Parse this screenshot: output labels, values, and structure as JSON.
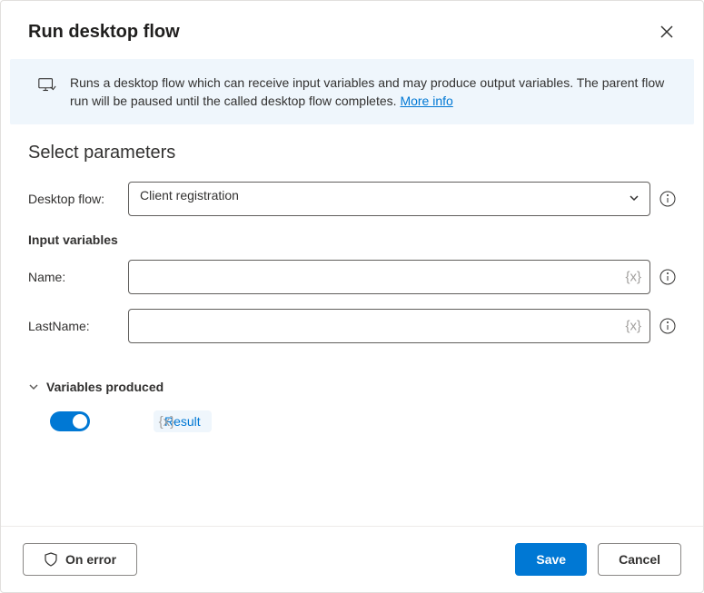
{
  "dialog": {
    "title": "Run desktop flow",
    "description": "Runs a desktop flow which can receive input variables and may produce output variables. The parent flow run will be paused until the called desktop flow completes.",
    "moreInfoLabel": "More info"
  },
  "parameters": {
    "heading": "Select parameters",
    "desktopFlowLabel": "Desktop flow:",
    "desktopFlowValue": "Client registration",
    "inputVariablesHeading": "Input variables",
    "inputs": {
      "nameLabel": "Name:",
      "nameValue": "",
      "lastNameLabel": "LastName:",
      "lastNameValue": ""
    }
  },
  "variablesProduced": {
    "heading": "Variables produced",
    "toggleOn": true,
    "resultLabel": "Result"
  },
  "footer": {
    "onErrorLabel": "On error",
    "saveLabel": "Save",
    "cancelLabel": "Cancel"
  }
}
